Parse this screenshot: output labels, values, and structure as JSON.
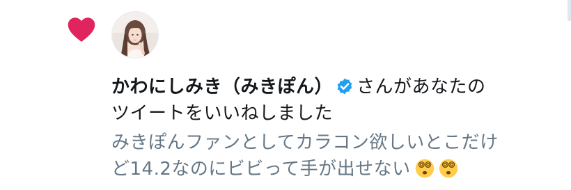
{
  "notification": {
    "type_icon": "heart-icon",
    "avatar_icon": "avatar",
    "display_name": "かわにしみき（みきぽん）",
    "verified_icon": "verified-badge-icon",
    "action_line1": "さんがあなたの",
    "action_line2": "ツイートをいいねしました",
    "tweet_text_line1": "みきぽんファンとしてカラコン欲しいとこだけ",
    "tweet_text_line2": "ど14.2なのにビビって手が出せない",
    "emoji_icons": [
      "dizzy-face-icon",
      "dizzy-face-icon"
    ],
    "colors": {
      "heart": "#e0245e",
      "verified": "#1da1f2",
      "text": "#14171a",
      "secondary_text": "#657786",
      "emoji": "#ffcc4d"
    }
  }
}
